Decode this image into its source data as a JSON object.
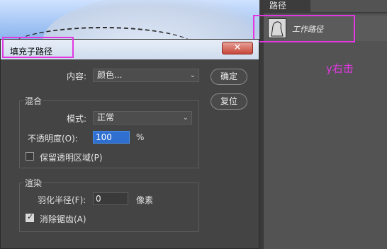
{
  "panel": {
    "tab_label": "路径",
    "path_item": "工作路径"
  },
  "annotation": {
    "hint": "y右击"
  },
  "dialog": {
    "title": "填充子路径",
    "close_glyph": "✕",
    "content_label": "内容:",
    "content_value": "颜色...",
    "ok_label": "确定",
    "reset_label": "复位",
    "blend": {
      "group_title": "混合",
      "mode_label": "模式:",
      "mode_value": "正常",
      "opacity_label": "不透明度(O):",
      "opacity_value": "100",
      "opacity_unit": "%",
      "preserve_label": "保留透明区域(P)",
      "preserve_checked": false
    },
    "render": {
      "group_title": "渲染",
      "feather_label": "羽化半径(F):",
      "feather_value": "0",
      "feather_unit": "像素",
      "antialias_label": "消除锯齿(A)",
      "antialias_checked": true
    }
  },
  "colors": {
    "highlight": "#e138e1",
    "selection": "#2e6fd0"
  }
}
